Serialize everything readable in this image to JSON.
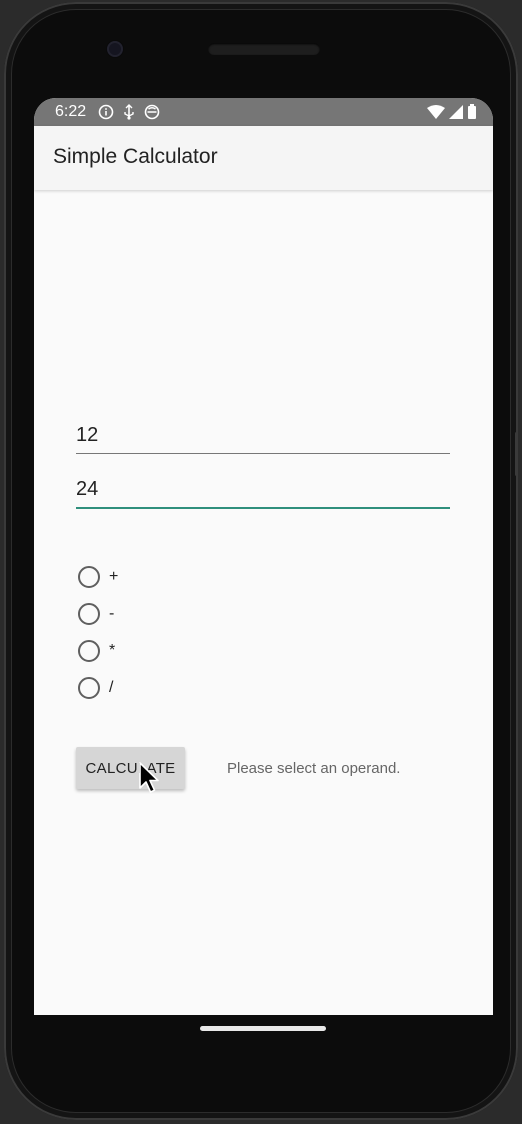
{
  "status_bar": {
    "time": "6:22",
    "left_icons": [
      "info-icon",
      "usb-debug-icon",
      "sync-icon"
    ],
    "right_icons": [
      "wifi-icon",
      "signal-icon",
      "battery-icon"
    ]
  },
  "app_bar": {
    "title": "Simple Calculator"
  },
  "inputs": {
    "first_number": "12",
    "second_number": "24"
  },
  "operations": [
    {
      "label": "+",
      "selected": false
    },
    {
      "label": "-",
      "selected": false
    },
    {
      "label": "*",
      "selected": false
    },
    {
      "label": "/",
      "selected": false
    }
  ],
  "calculate_button": {
    "label": "CALCULATE"
  },
  "result": {
    "message": "Please select an operand."
  },
  "colors": {
    "accent": "#2f8f7c",
    "status_bar": "#767676",
    "app_bar": "#f5f5f5",
    "button": "#d6d6d6"
  }
}
